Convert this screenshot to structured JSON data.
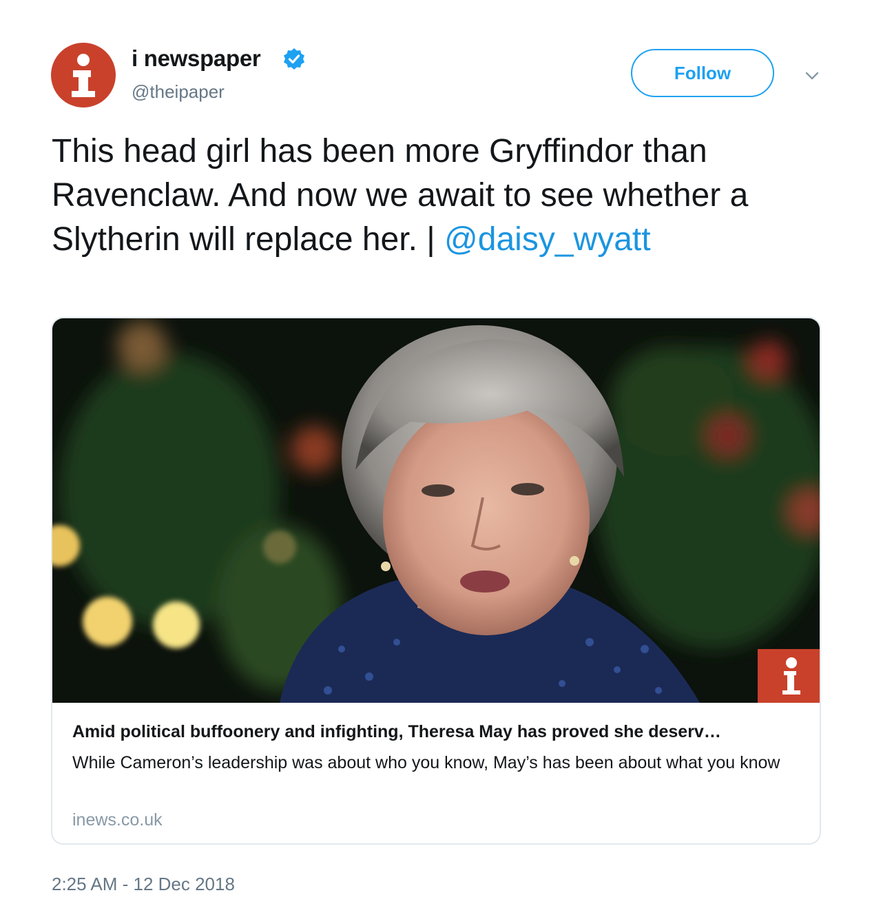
{
  "account": {
    "display_name": "i newspaper",
    "handle": "@theipaper",
    "avatar_icon": "i-logo-icon",
    "avatar_color": "#c9412b",
    "verified": true
  },
  "actions": {
    "follow_label": "Follow",
    "menu_icon": "chevron-down-icon"
  },
  "tweet": {
    "text": "This head girl has been more Gryffindor than Ravenclaw. And now we await to see whether a Slytherin will replace her. | ",
    "mention": "@daisy_wyatt",
    "timestamp": "2:25 AM - 12 Dec 2018"
  },
  "card": {
    "title": "Amid political buffoonery and infighting, Theresa May has proved she deserv…",
    "description": "While Cameron’s leadership was about who you know, May’s has been about what you know",
    "domain": "inews.co.uk"
  },
  "colors": {
    "accent": "#1da1f2",
    "link": "#1b95e0",
    "brand": "#c9412b",
    "muted": "#657786"
  }
}
